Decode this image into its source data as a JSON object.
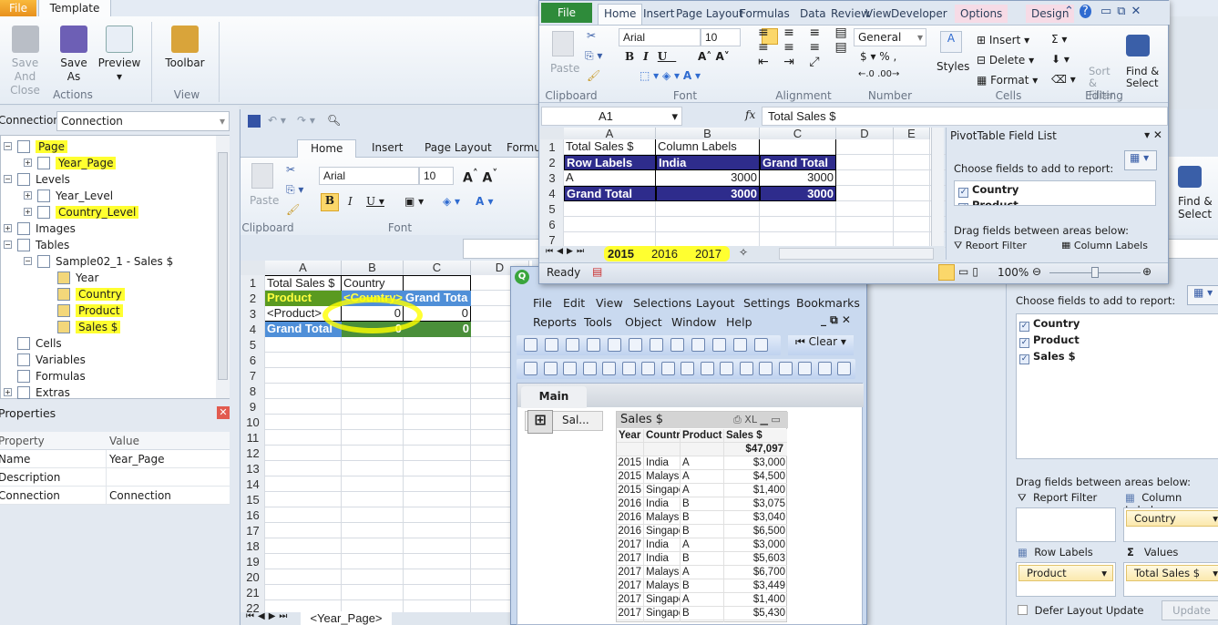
{
  "app": {
    "file_tab": "File",
    "template_tab": "Template",
    "buttons": [
      {
        "label": "Save And Close"
      },
      {
        "label": "Save As"
      },
      {
        "label": "Preview"
      },
      {
        "label": "Toolbar"
      }
    ],
    "groups": {
      "actions": "Actions",
      "view": "View"
    },
    "connection_label": "Connection",
    "connection_value": "Connection",
    "tree": [
      {
        "label": "Page",
        "level": 0,
        "hl": true,
        "exp": "-"
      },
      {
        "label": "Year_Page",
        "level": 1,
        "hl": true,
        "exp": "+"
      },
      {
        "label": "Levels",
        "level": 0,
        "hl": false,
        "exp": "-"
      },
      {
        "label": "Year_Level",
        "level": 1,
        "hl": false,
        "exp": "+"
      },
      {
        "label": "Country_Level",
        "level": 1,
        "hl": true,
        "exp": "+"
      },
      {
        "label": "Images",
        "level": 0,
        "hl": false,
        "exp": "+"
      },
      {
        "label": "Tables",
        "level": 0,
        "hl": false,
        "exp": "-"
      },
      {
        "label": "Sample02_1 - Sales $",
        "level": 1,
        "hl": false,
        "exp": "-"
      },
      {
        "label": "Year",
        "level": 2,
        "hl": false,
        "exp": ""
      },
      {
        "label": "Country",
        "level": 2,
        "hl": true,
        "exp": ""
      },
      {
        "label": "Product",
        "level": 2,
        "hl": true,
        "exp": ""
      },
      {
        "label": "Sales $",
        "level": 2,
        "hl": true,
        "exp": ""
      },
      {
        "label": "Cells",
        "level": 0,
        "hl": false,
        "exp": ""
      },
      {
        "label": "Variables",
        "level": 0,
        "hl": false,
        "exp": ""
      },
      {
        "label": "Formulas",
        "level": 0,
        "hl": false,
        "exp": ""
      },
      {
        "label": "Extras",
        "level": 0,
        "hl": false,
        "exp": "+"
      }
    ],
    "properties": {
      "title": "Properties",
      "headers": [
        "Property",
        "Value"
      ],
      "rows": [
        [
          "Name",
          "Year_Page"
        ],
        [
          "Description",
          ""
        ],
        [
          "Connection",
          "Connection"
        ]
      ]
    }
  },
  "bg_excel": {
    "tabs": [
      "Home",
      "Insert",
      "Page Layout",
      "Formulas"
    ],
    "font": "Arial",
    "size": "10",
    "groups": [
      "Clipboard",
      "Font"
    ],
    "paste": "Paste",
    "columns": [
      "A",
      "B",
      "C",
      "D"
    ],
    "cells": [
      [
        "Total Sales $",
        "Country",
        ""
      ],
      [
        "Product",
        "<Country>",
        "Grand Tota"
      ],
      [
        "<Product>",
        "0",
        "0"
      ],
      [
        "Grand Total",
        "0",
        "0"
      ]
    ],
    "row_count": 22,
    "sheet_tab": "<Year_Page>"
  },
  "fg_excel": {
    "tabs": [
      "File",
      "Home",
      "Insert",
      "Page Layout",
      "Formulas",
      "Data",
      "Review",
      "View",
      "Developer",
      "Options",
      "Design"
    ],
    "font": "Arial",
    "size": "10",
    "number_format": "General",
    "paste": "Paste",
    "styles": "Styles",
    "cells_buttons": [
      "Insert",
      "Delete",
      "Format"
    ],
    "sort_filter": "Sort & Filter",
    "find_select": "Find & Select",
    "groups": [
      "Clipboard",
      "Font",
      "Alignment",
      "Number",
      "Cells",
      "Editing"
    ],
    "name_box": "A1",
    "formula": "Total Sales $",
    "columns": [
      "A",
      "B",
      "C",
      "D",
      "E"
    ],
    "cells": [
      [
        "Total Sales $",
        "Column Labels",
        ""
      ],
      [
        "Row Labels",
        "India",
        "Grand Total"
      ],
      [
        "A",
        "3000",
        "3000"
      ],
      [
        "Grand Total",
        "3000",
        "3000"
      ]
    ],
    "row_count": 7,
    "sheet_tabs": [
      "2015",
      "2016",
      "2017"
    ],
    "status": "Ready",
    "zoom": "100%",
    "zoom_level": 0.5,
    "field_list": {
      "title": "PivotTable Field List",
      "choose": "Choose fields to add to report:",
      "fields": [
        "Country",
        "Product"
      ],
      "drag": "Drag fields between areas below:",
      "report_filter": "Report Filter",
      "column_labels": "Column Labels"
    }
  },
  "qlik": {
    "menu1": [
      "File",
      "Edit",
      "View",
      "Selections",
      "Layout",
      "Settings",
      "Bookmarks"
    ],
    "menu2": [
      "Reports",
      "Tools",
      "Object",
      "Window",
      "Help"
    ],
    "clear": "Clear",
    "sheet_tab": "Main",
    "minimized": "Sal...",
    "table": {
      "title": "Sales $",
      "xl": "XL",
      "headers": [
        "Year",
        "Country",
        "Product",
        "Sales $"
      ],
      "total": "$47,097",
      "rows": [
        [
          "2015",
          "India",
          "A",
          "$3,000"
        ],
        [
          "2015",
          "Malaysia",
          "A",
          "$4,500"
        ],
        [
          "2015",
          "Singapore",
          "A",
          "$1,400"
        ],
        [
          "2016",
          "India",
          "B",
          "$3,075"
        ],
        [
          "2016",
          "Malaysia",
          "B",
          "$3,040"
        ],
        [
          "2016",
          "Singapore",
          "B",
          "$6,500"
        ],
        [
          "2017",
          "India",
          "A",
          "$3,000"
        ],
        [
          "2017",
          "India",
          "B",
          "$5,603"
        ],
        [
          "2017",
          "Malaysia",
          "A",
          "$6,700"
        ],
        [
          "2017",
          "Malaysia",
          "B",
          "$3,449"
        ],
        [
          "2017",
          "Singapore",
          "A",
          "$1,400"
        ],
        [
          "2017",
          "Singapore",
          "B",
          "$5,430"
        ]
      ]
    }
  },
  "right_pane": {
    "find_select": "Find & Select",
    "choose": "Choose fields to add to report:",
    "fields": [
      "Country",
      "Product",
      "Sales $"
    ],
    "drag": "Drag fields between areas below:",
    "report_filter": "Report Filter",
    "column_labels": "Column Labels",
    "row_labels": "Row Labels",
    "values": "Values",
    "column_field": "Country",
    "row_field": "Product",
    "value_field": "Total Sales $",
    "defer": "Defer Layout Update",
    "update": "Update"
  },
  "colors": {
    "pivot_dark": "#2e2c8c",
    "pivot_light": "#4f8fd8",
    "highlight": "#ffff30",
    "file_orange": "#e8911d",
    "file_green": "#2e8b3a"
  }
}
